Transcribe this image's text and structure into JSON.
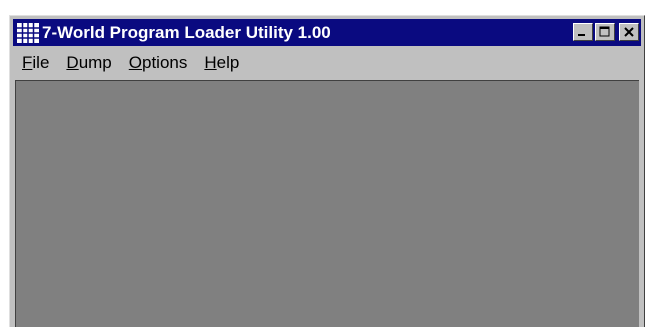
{
  "window": {
    "title": "7-World Program Loader Utility 1.00",
    "colors": {
      "titlebar": "#0a0a80",
      "face": "#c0c0c0",
      "client": "#808080"
    }
  },
  "title_buttons": [
    {
      "name": "minimize-button",
      "icon": "minimize-icon"
    },
    {
      "name": "maximize-button",
      "icon": "maximize-icon"
    },
    {
      "name": "close-button",
      "icon": "close-icon"
    }
  ],
  "menu": [
    {
      "key": "F",
      "rest": "ile"
    },
    {
      "key": "D",
      "rest": "ump"
    },
    {
      "key": "O",
      "rest": "ptions"
    },
    {
      "key": "H",
      "rest": "elp"
    }
  ]
}
